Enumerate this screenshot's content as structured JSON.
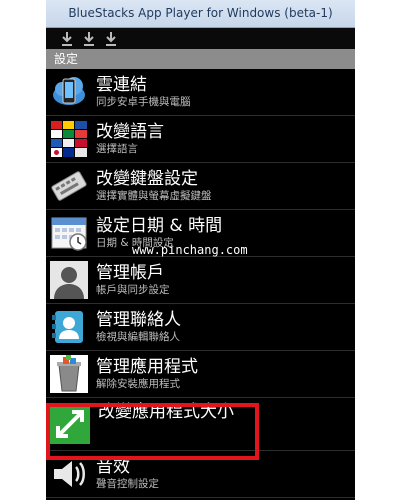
{
  "window": {
    "title": "BlueStacks App Player for Windows (beta-1)"
  },
  "header": {
    "title": "設定"
  },
  "items": [
    {
      "title": "雲連結",
      "subtitle": "同步安卓手機與電腦",
      "icon": "cloud-phone-icon"
    },
    {
      "title": "改變語言",
      "subtitle": "選擇語言",
      "icon": "flags-language-icon"
    },
    {
      "title": "改變鍵盤設定",
      "subtitle": "選擇實體與螢幕虛擬鍵盤",
      "icon": "keyboard-icon"
    },
    {
      "title": "設定日期 & 時間",
      "subtitle": "日期 & 時間設定",
      "icon": "calendar-icon"
    },
    {
      "title": "管理帳戶",
      "subtitle": "帳戶與同步設定",
      "icon": "user-account-icon"
    },
    {
      "title": "管理聯絡人",
      "subtitle": "檢視與編輯聯絡人",
      "icon": "contacts-icon"
    },
    {
      "title": "管理應用程式",
      "subtitle": "解除安裝應用程式",
      "icon": "trash-bin-icon"
    },
    {
      "title": "改變應用程式大小",
      "subtitle": "",
      "icon": "resize-arrows-icon"
    },
    {
      "title": "音效",
      "subtitle": "聲音控制設定",
      "icon": "speaker-icon"
    }
  ],
  "watermark": "www.pinchang.com",
  "colors": {
    "highlight": "#e0161c",
    "resize_icon": "#2fa73a",
    "header_bg": "#8c8c8c"
  }
}
